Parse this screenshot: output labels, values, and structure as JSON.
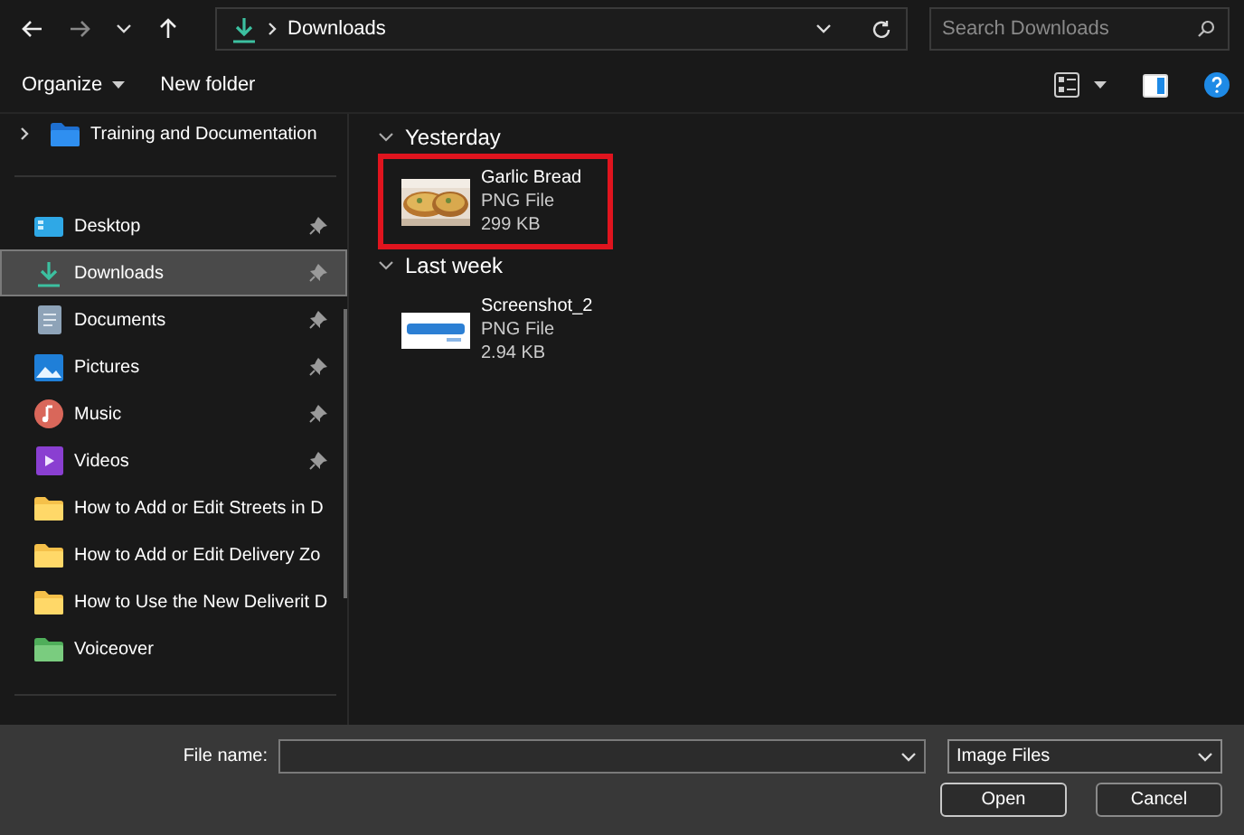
{
  "address_bar": {
    "location": "Downloads"
  },
  "search": {
    "placeholder": "Search Downloads"
  },
  "toolbar": {
    "organize": "Organize",
    "new_folder": "New folder"
  },
  "sidebar": {
    "top_item": {
      "label": "Training and Documentation",
      "expanded": false
    },
    "items": [
      {
        "label": "Desktop",
        "kind": "desktop",
        "pinned": true,
        "selected": false
      },
      {
        "label": "Downloads",
        "kind": "downloads",
        "pinned": true,
        "selected": true
      },
      {
        "label": "Documents",
        "kind": "documents",
        "pinned": true,
        "selected": false
      },
      {
        "label": "Pictures",
        "kind": "pictures",
        "pinned": true,
        "selected": false
      },
      {
        "label": "Music",
        "kind": "music",
        "pinned": true,
        "selected": false
      },
      {
        "label": "Videos",
        "kind": "videos",
        "pinned": true,
        "selected": false
      },
      {
        "label": "How to Add or Edit Streets in D",
        "kind": "folder",
        "pinned": false,
        "selected": false
      },
      {
        "label": "How to Add or Edit Delivery Zo",
        "kind": "folder",
        "pinned": false,
        "selected": false
      },
      {
        "label": "How to Use the New Deliverit D",
        "kind": "folder",
        "pinned": false,
        "selected": false
      },
      {
        "label": "Voiceover",
        "kind": "green-folder",
        "pinned": false,
        "selected": false
      }
    ]
  },
  "groups": [
    {
      "title": "Yesterday",
      "expanded": true,
      "files": [
        {
          "name": "Garlic Bread",
          "type": "PNG File",
          "size": "299 KB",
          "highlighted": true
        }
      ]
    },
    {
      "title": "Last week",
      "expanded": true,
      "files": [
        {
          "name": "Screenshot_2",
          "type": "PNG File",
          "size": "2.94 KB",
          "highlighted": false
        }
      ]
    }
  ],
  "footer": {
    "file_name_label": "File name:",
    "file_type": "Image Files",
    "buttons": [
      "Open",
      "Cancel"
    ]
  }
}
